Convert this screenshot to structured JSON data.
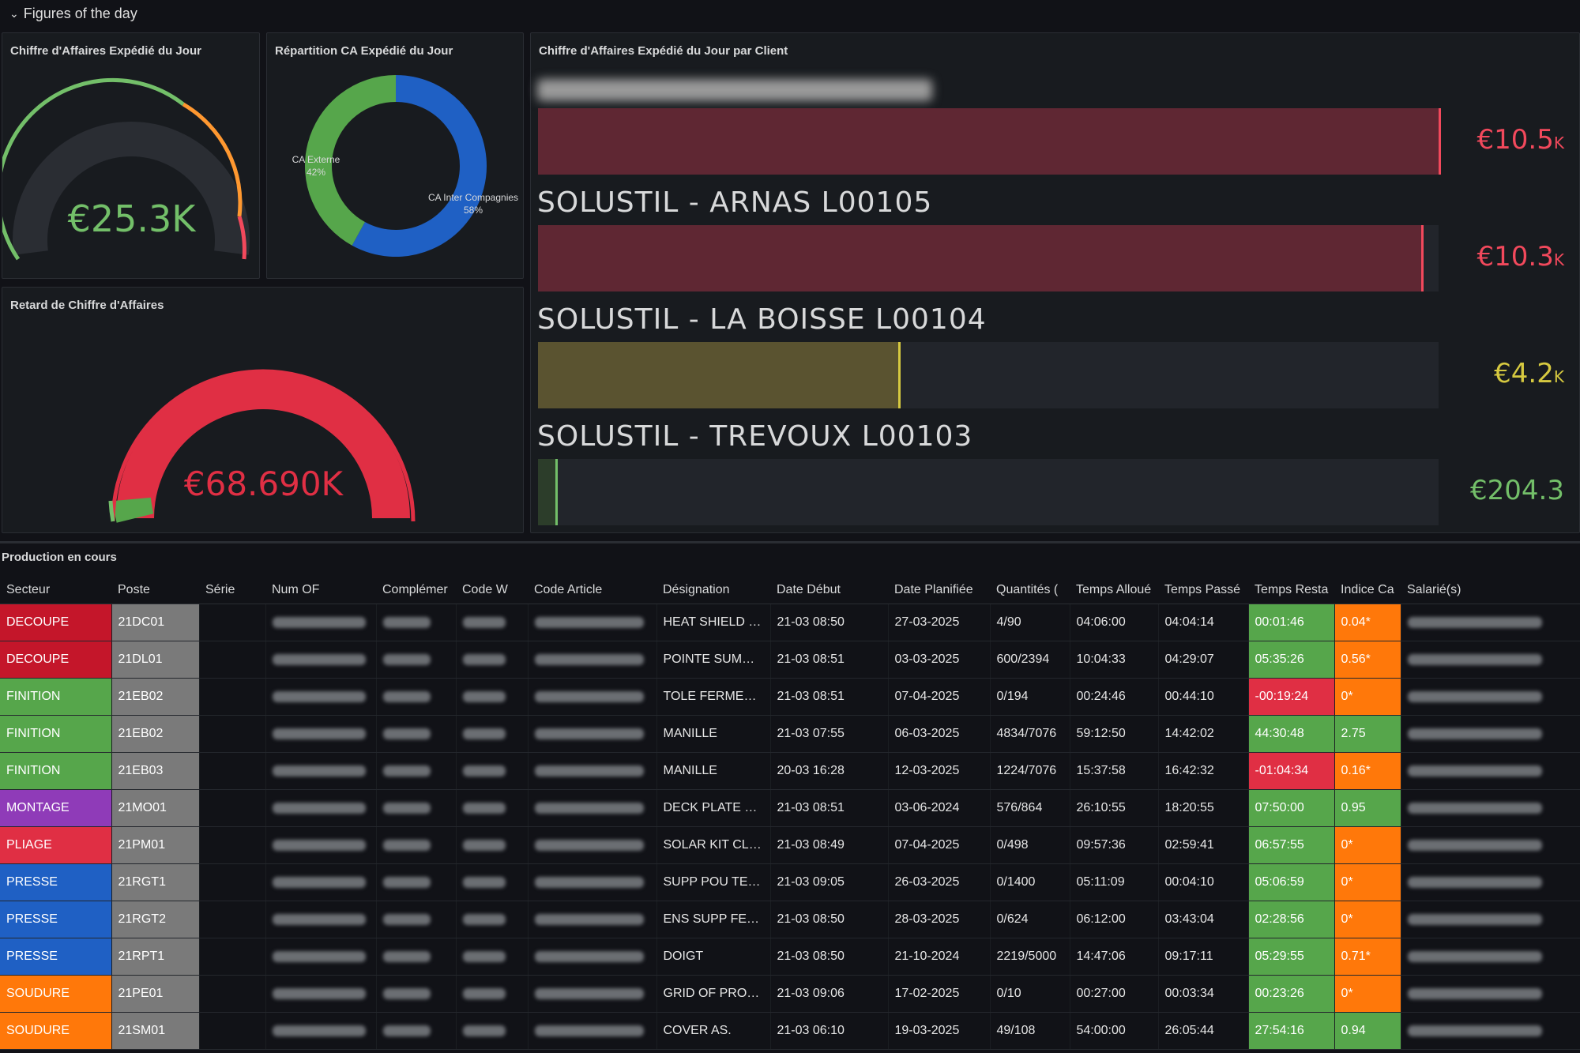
{
  "row_title": "Figures of the day",
  "colors": {
    "green": "#73bf69",
    "red": "#f2495c",
    "yellow": "#d6c940",
    "orange": "#ff780a",
    "blue": "#3274d9",
    "purple": "#8f3bb8",
    "gray": "#7a7a7a",
    "crimson": "#c4162a"
  },
  "gauge1": {
    "title": "Chiffre d'Affaires Expédié du Jour",
    "value": "€25.3K",
    "fraction": 1.0
  },
  "donut": {
    "title": "Répartition CA Expédié du Jour",
    "slices": [
      {
        "label": "CA Externe",
        "pct_label": "42%",
        "value": 42,
        "color": "#56a64b"
      },
      {
        "label": "CA Inter Compagnies",
        "pct_label": "58%",
        "value": 58,
        "color": "#1f60c4"
      }
    ]
  },
  "gauge2": {
    "title": "Retard de Chiffre d'Affaires",
    "value": "€68.690K",
    "fraction": 0.97
  },
  "bars": {
    "title": "Chiffre d'Affaires Expédié du Jour par Client",
    "max": 10.5,
    "items": [
      {
        "label": "",
        "value": 10.5,
        "value_main": "€10.5",
        "value_unit": "K",
        "color": "#f2495c",
        "fill": "#5f2733",
        "redacted": true
      },
      {
        "label": "SOLUSTIL - ARNAS L00105",
        "value": 10.3,
        "value_main": "€10.3",
        "value_unit": "K",
        "color": "#f2495c",
        "fill": "#5f2733"
      },
      {
        "label": "SOLUSTIL - LA BOISSE L00104",
        "value": 4.2,
        "value_main": "€4.2",
        "value_unit": "K",
        "color": "#d6c940",
        "fill": "#5a5330"
      },
      {
        "label": "SOLUSTIL - TREVOUX L00103",
        "value": 0.2043,
        "value_main": "€204.3",
        "value_unit": "",
        "color": "#73bf69",
        "fill": "#2c3d2a"
      }
    ]
  },
  "table": {
    "title": "Production en cours",
    "headers": [
      "Secteur",
      "Poste",
      "Série",
      "Num OF",
      "Complémer",
      "Code W",
      "Code Article",
      "Désignation",
      "Date Début",
      "Date Planifiée",
      "Quantités (",
      "Temps Alloué",
      "Temps Passé",
      "Temps Resta",
      "Indice Ca",
      "Salarié(s)"
    ],
    "rows": [
      {
        "secteur": "DECOUPE",
        "sect_color": "#c4162a",
        "poste": "21DC01",
        "designation": "HEAT SHIELD E...",
        "debut": "21-03 08:50",
        "planif": "27-03-2025",
        "qte": "4/90",
        "alloue": "04:06:00",
        "passe": "04:04:14",
        "reste": "00:01:46",
        "reste_color": "#56a64b",
        "indice": "0.04*",
        "indice_color": "#ff780a"
      },
      {
        "secteur": "DECOUPE",
        "sect_color": "#c4162a",
        "poste": "21DL01",
        "designation": "POINTE SUMMIT",
        "debut": "21-03 08:51",
        "planif": "03-03-2025",
        "qte": "600/2394",
        "alloue": "10:04:33",
        "passe": "04:29:07",
        "reste": "05:35:26",
        "reste_color": "#56a64b",
        "indice": "0.56*",
        "indice_color": "#ff780a"
      },
      {
        "secteur": "FINITION",
        "sect_color": "#56a64b",
        "poste": "21EB02",
        "designation": "TOLE FERMETU...",
        "debut": "21-03 08:51",
        "planif": "07-04-2025",
        "qte": "0/194",
        "alloue": "00:24:46",
        "passe": "00:44:10",
        "reste": "-00:19:24",
        "reste_color": "#e02f44",
        "indice": "0*",
        "indice_color": "#ff780a"
      },
      {
        "secteur": "FINITION",
        "sect_color": "#56a64b",
        "poste": "21EB02",
        "designation": "MANILLE",
        "debut": "21-03 07:55",
        "planif": "06-03-2025",
        "qte": "4834/7076",
        "alloue": "59:12:50",
        "passe": "14:42:02",
        "reste": "44:30:48",
        "reste_color": "#56a64b",
        "indice": "2.75",
        "indice_color": "#56a64b"
      },
      {
        "secteur": "FINITION",
        "sect_color": "#56a64b",
        "poste": "21EB03",
        "designation": "MANILLE",
        "debut": "20-03 16:28",
        "planif": "12-03-2025",
        "qte": "1224/7076",
        "alloue": "15:37:58",
        "passe": "16:42:32",
        "reste": "-01:04:34",
        "reste_color": "#e02f44",
        "indice": "0.16*",
        "indice_color": "#ff780a"
      },
      {
        "secteur": "MONTAGE",
        "sect_color": "#8f3bb8",
        "poste": "21MO01",
        "designation": "DECK PLATE CE...",
        "debut": "21-03 08:51",
        "planif": "03-06-2024",
        "qte": "576/864",
        "alloue": "26:10:55",
        "passe": "18:20:55",
        "reste": "07:50:00",
        "reste_color": "#56a64b",
        "indice": "0.95",
        "indice_color": "#56a64b"
      },
      {
        "secteur": "PLIAGE",
        "sect_color": "#e02f44",
        "poste": "21PM01",
        "designation": "SOLAR KIT CLA...",
        "debut": "21-03 08:49",
        "planif": "07-04-2025",
        "qte": "0/498",
        "alloue": "09:57:36",
        "passe": "02:59:41",
        "reste": "06:57:55",
        "reste_color": "#56a64b",
        "indice": "0*",
        "indice_color": "#ff780a"
      },
      {
        "secteur": "PRESSE",
        "sect_color": "#1f60c4",
        "poste": "21RGT1",
        "designation": "SUPP POU TEN...",
        "debut": "21-03 09:05",
        "planif": "26-03-2025",
        "qte": "0/1400",
        "alloue": "05:11:09",
        "passe": "00:04:10",
        "reste": "05:06:59",
        "reste_color": "#56a64b",
        "indice": "0*",
        "indice_color": "#ff780a"
      },
      {
        "secteur": "PRESSE",
        "sect_color": "#1f60c4",
        "poste": "21RGT2",
        "designation": "ENS SUPP FEU...",
        "debut": "21-03 08:50",
        "planif": "28-03-2025",
        "qte": "0/624",
        "alloue": "06:12:00",
        "passe": "03:43:04",
        "reste": "02:28:56",
        "reste_color": "#56a64b",
        "indice": "0*",
        "indice_color": "#ff780a"
      },
      {
        "secteur": "PRESSE",
        "sect_color": "#1f60c4",
        "poste": "21RPT1",
        "designation": "DOIGT",
        "debut": "21-03 08:50",
        "planif": "21-10-2024",
        "qte": "2219/5000",
        "alloue": "14:47:06",
        "passe": "09:17:11",
        "reste": "05:29:55",
        "reste_color": "#56a64b",
        "indice": "0.71*",
        "indice_color": "#ff780a"
      },
      {
        "secteur": "SOUDURE",
        "sect_color": "#ff780a",
        "poste": "21PE01",
        "designation": "GRID OF PROTE...",
        "debut": "21-03 09:06",
        "planif": "17-02-2025",
        "qte": "0/10",
        "alloue": "00:27:00",
        "passe": "00:03:34",
        "reste": "00:23:26",
        "reste_color": "#56a64b",
        "indice": "0*",
        "indice_color": "#ff780a"
      },
      {
        "secteur": "SOUDURE",
        "sect_color": "#ff780a",
        "poste": "21SM01",
        "designation": "COVER AS.",
        "debut": "21-03 06:10",
        "planif": "19-03-2025",
        "qte": "49/108",
        "alloue": "54:00:00",
        "passe": "26:05:44",
        "reste": "27:54:16",
        "reste_color": "#56a64b",
        "indice": "0.94",
        "indice_color": "#56a64b"
      }
    ]
  }
}
